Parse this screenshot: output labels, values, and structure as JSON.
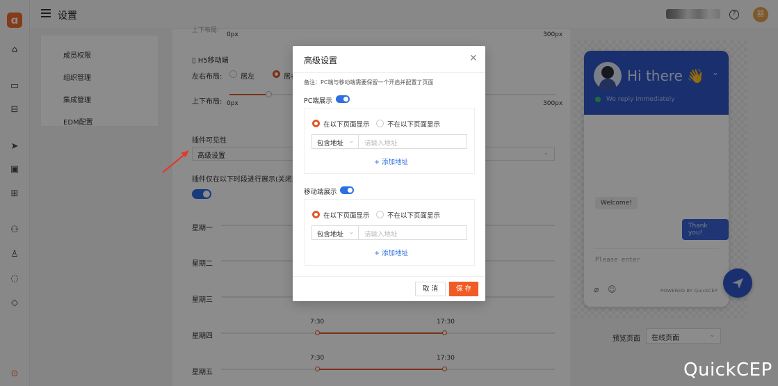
{
  "topbar": {
    "title": "设置"
  },
  "leftmenu": {
    "items": [
      "成员权限",
      "组织管理",
      "集成管理",
      "EDM配置"
    ]
  },
  "form": {
    "top_layout_label": "上下布局:",
    "top_min": "0px",
    "top_max": "300px",
    "h5_title": "H5移动端",
    "lr_layout_label": "左右布局:",
    "lr_left": "居左",
    "lr_right": "居右",
    "ud_layout_label": "上下布局:",
    "ud_min": "0px",
    "ud_max": "300px",
    "visibility_label": "插件可见性",
    "visibility_value": "高级设置",
    "time_label": "插件仅在以下时段进行展示(关闭则",
    "days": [
      {
        "name": "星期一",
        "start": "",
        "end": ""
      },
      {
        "name": "星期二",
        "start": "",
        "end": ""
      },
      {
        "name": "星期三",
        "start": "",
        "end": ""
      },
      {
        "name": "星期四",
        "start": "7:30",
        "end": "17:30"
      },
      {
        "name": "星期五",
        "start": "7:30",
        "end": "17:30"
      }
    ]
  },
  "preview": {
    "greeting": "Hi there 👋",
    "status": "We reply immediately",
    "welcome": "Welcome!",
    "thanks": "Thank you!",
    "placeholder": "Please enter",
    "powered": "POWERED BY QuickCEP",
    "page_label": "预览页面",
    "page_value": "在线页面",
    "brand_color": "#2f56c8"
  },
  "modal": {
    "title": "高级设置",
    "note": "备注：PC端与移动端需要保留一个开启并配置了页面",
    "pc_label": "PC端展示",
    "mobile_label": "移动端展示",
    "show_on": "在以下页面显示",
    "hide_on": "不在以下页面显示",
    "include": "包含地址",
    "addr_placeholder": "请输入地址",
    "add_address": "+ 添加地址",
    "cancel": "取 消",
    "save": "保 存"
  },
  "watermark": "QuickCEP",
  "colors": {
    "accent": "#e15a2b",
    "toggle": "#2d6ee0",
    "save_button": "#f15b24"
  }
}
